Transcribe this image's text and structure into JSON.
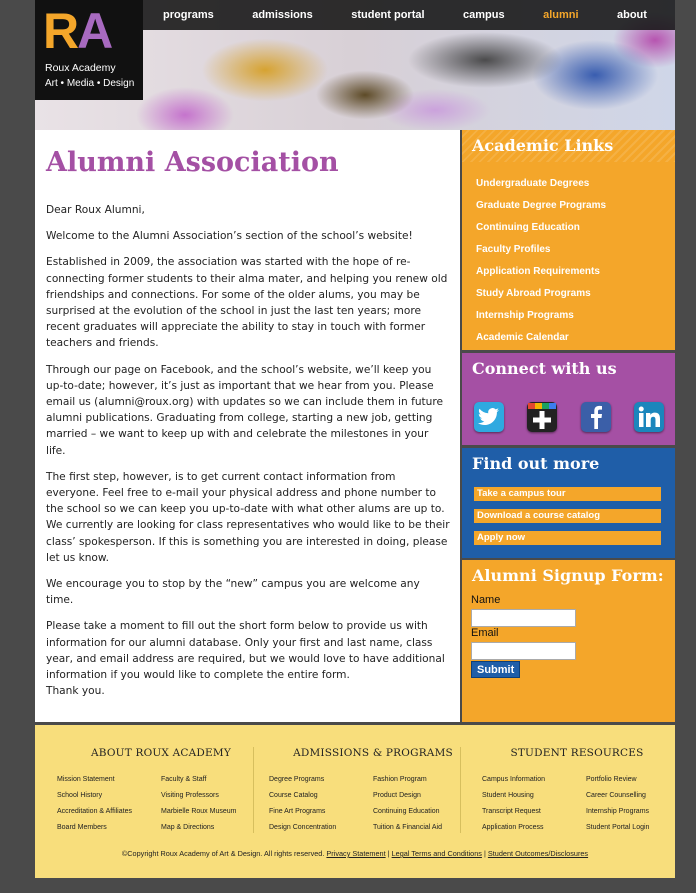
{
  "logo": {
    "letters_r": "R",
    "letters_a": "A",
    "name": "Roux Academy",
    "subtitle": "Art • Media • Design"
  },
  "nav": [
    {
      "label": "programs",
      "active": false
    },
    {
      "label": "admissions",
      "active": false
    },
    {
      "label": "student portal",
      "active": false
    },
    {
      "label": "campus",
      "active": false
    },
    {
      "label": "alumni",
      "active": true
    },
    {
      "label": "about",
      "active": false
    }
  ],
  "main": {
    "title": "Alumni Association",
    "paragraphs": [
      "Dear Roux Alumni,",
      "Welcome to the Alumni Association’s section of the school’s website!",
      "Established in 2009, the association was started with the hope of re-connecting former students to their alma mater, and helping you renew old friendships and connections. For some of the older alums, you may be surprised at the evolution of the school in just the last ten years; more recent graduates will appreciate the ability to stay in touch with former teachers and friends.",
      "Through our page on Facebook, and the school’s website, we’ll keep you up-to-date; however, it’s just as important that we hear from you. Please email us (alumni@roux.org) with updates so we can include them in future alumni publications. Graduating from college, starting a new job, getting married – we want to keep up with and celebrate the milestones in your life.",
      "The first step, however, is to get current contact information from everyone. Feel free to e-mail your physical address and phone number to the school so we can keep you up-to-date with what other alums are up to. We currently are looking for class representatives who would like to be their class’ spokesperson. If this is something you are interested in doing, please let us know.",
      "We encourage you to stop by the “new” campus you are welcome any time.",
      "Please take a moment to fill out the short form below to provide us with information for our alumni database. Only your first and last name, class year, and email address are required, but we would love to have additional information if you would like to complete the entire form.",
      "Thank you."
    ]
  },
  "sidebar": {
    "academic": {
      "title": "Academic Links",
      "links": [
        "Undergraduate Degrees",
        "Graduate Degree Programs",
        "Continuing Education",
        "Faculty Profiles",
        "Application Requirements",
        "Study Abroad Programs",
        "Internship Programs",
        "Academic Calendar"
      ]
    },
    "connect": {
      "title": "Connect with us",
      "icons": [
        "twitter-icon",
        "google-plus-icon",
        "facebook-icon",
        "linkedin-icon"
      ]
    },
    "findout": {
      "title": "Find out more",
      "buttons": [
        "Take a campus tour",
        "Download a course catalog",
        "Apply now"
      ]
    },
    "signup": {
      "title": "Alumni Signup Form:",
      "name_label": "Name",
      "email_label": "Email",
      "name_value": "",
      "email_value": "",
      "submit_label": "Submit"
    }
  },
  "footer": {
    "columns": [
      {
        "title": "ABOUT ROUX ACADEMY",
        "links": [
          "Mission Statement",
          "Faculty & Staff",
          "School History",
          "Visiting Professors",
          "Accreditation & Affiliates",
          "Marbielle Roux Museum",
          "Board Members",
          "Map & Directions"
        ]
      },
      {
        "title": "ADMISSIONS & PROGRAMS",
        "links": [
          "Degree Programs",
          "Fashion Program",
          "Course Catalog",
          "Product Design",
          "Fine Art Programs",
          "Continuing Education",
          "Design Concentration",
          "Tuition & Financial Aid"
        ]
      },
      {
        "title": "STUDENT RESOURCES",
        "links": [
          "Campus Information",
          "Portfolio Review",
          "Student Housing",
          "Career Counselling",
          "Transcript Request",
          "Internship Programs",
          "Application Process",
          "Student Portal Login"
        ]
      }
    ],
    "copyright": "©Copyright Roux Academy of Art & Design. All rights reserved.",
    "legal_links": [
      "Privacy Statement",
      "Legal Terms and Conditions",
      "Student Outcomes/Disclosures"
    ],
    "separator": "|"
  },
  "colors": {
    "orange": "#f4a62a",
    "purple": "#a550a4",
    "blue": "#1f5ea8",
    "footer_yellow": "#f8de7c",
    "title_purple": "#a450a4"
  }
}
